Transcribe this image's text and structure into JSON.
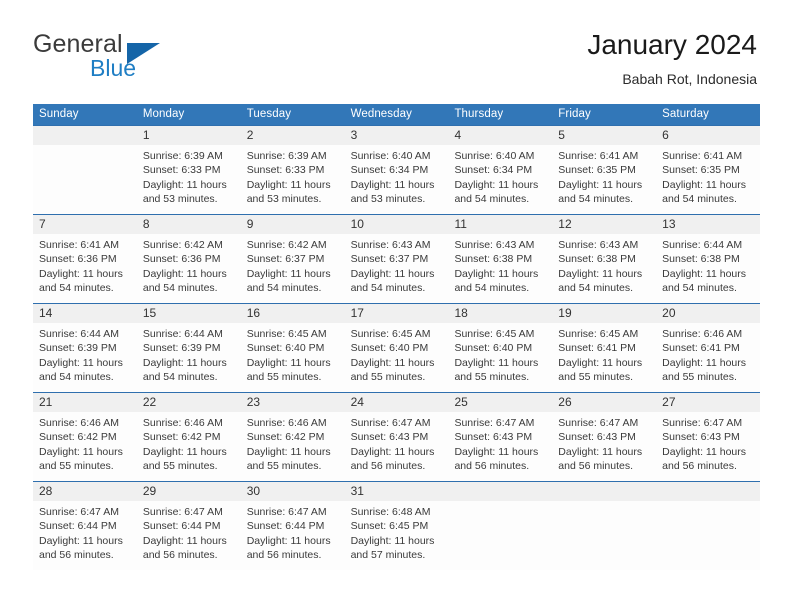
{
  "brand": {
    "name_top": "General",
    "name_bottom": "Blue",
    "triangle_color": "#1565a8",
    "blue_color": "#1f7ec4"
  },
  "header": {
    "title": "January 2024",
    "subtitle": "Babah Rot, Indonesia"
  },
  "theme": {
    "header_blue": "#3277b8",
    "daynum_band": "#f0f0f0",
    "separator_blue": "#2f6fae"
  },
  "weekdays": [
    "Sunday",
    "Monday",
    "Tuesday",
    "Wednesday",
    "Thursday",
    "Friday",
    "Saturday"
  ],
  "weeks": [
    {
      "days": [
        {
          "num": "",
          "l1": "",
          "l2": "",
          "l3": "",
          "l4": ""
        },
        {
          "num": "1",
          "l1": "Sunrise: 6:39 AM",
          "l2": "Sunset: 6:33 PM",
          "l3": "Daylight: 11 hours",
          "l4": "and 53 minutes."
        },
        {
          "num": "2",
          "l1": "Sunrise: 6:39 AM",
          "l2": "Sunset: 6:33 PM",
          "l3": "Daylight: 11 hours",
          "l4": "and 53 minutes."
        },
        {
          "num": "3",
          "l1": "Sunrise: 6:40 AM",
          "l2": "Sunset: 6:34 PM",
          "l3": "Daylight: 11 hours",
          "l4": "and 53 minutes."
        },
        {
          "num": "4",
          "l1": "Sunrise: 6:40 AM",
          "l2": "Sunset: 6:34 PM",
          "l3": "Daylight: 11 hours",
          "l4": "and 54 minutes."
        },
        {
          "num": "5",
          "l1": "Sunrise: 6:41 AM",
          "l2": "Sunset: 6:35 PM",
          "l3": "Daylight: 11 hours",
          "l4": "and 54 minutes."
        },
        {
          "num": "6",
          "l1": "Sunrise: 6:41 AM",
          "l2": "Sunset: 6:35 PM",
          "l3": "Daylight: 11 hours",
          "l4": "and 54 minutes."
        }
      ]
    },
    {
      "days": [
        {
          "num": "7",
          "l1": "Sunrise: 6:41 AM",
          "l2": "Sunset: 6:36 PM",
          "l3": "Daylight: 11 hours",
          "l4": "and 54 minutes."
        },
        {
          "num": "8",
          "l1": "Sunrise: 6:42 AM",
          "l2": "Sunset: 6:36 PM",
          "l3": "Daylight: 11 hours",
          "l4": "and 54 minutes."
        },
        {
          "num": "9",
          "l1": "Sunrise: 6:42 AM",
          "l2": "Sunset: 6:37 PM",
          "l3": "Daylight: 11 hours",
          "l4": "and 54 minutes."
        },
        {
          "num": "10",
          "l1": "Sunrise: 6:43 AM",
          "l2": "Sunset: 6:37 PM",
          "l3": "Daylight: 11 hours",
          "l4": "and 54 minutes."
        },
        {
          "num": "11",
          "l1": "Sunrise: 6:43 AM",
          "l2": "Sunset: 6:38 PM",
          "l3": "Daylight: 11 hours",
          "l4": "and 54 minutes."
        },
        {
          "num": "12",
          "l1": "Sunrise: 6:43 AM",
          "l2": "Sunset: 6:38 PM",
          "l3": "Daylight: 11 hours",
          "l4": "and 54 minutes."
        },
        {
          "num": "13",
          "l1": "Sunrise: 6:44 AM",
          "l2": "Sunset: 6:38 PM",
          "l3": "Daylight: 11 hours",
          "l4": "and 54 minutes."
        }
      ]
    },
    {
      "days": [
        {
          "num": "14",
          "l1": "Sunrise: 6:44 AM",
          "l2": "Sunset: 6:39 PM",
          "l3": "Daylight: 11 hours",
          "l4": "and 54 minutes."
        },
        {
          "num": "15",
          "l1": "Sunrise: 6:44 AM",
          "l2": "Sunset: 6:39 PM",
          "l3": "Daylight: 11 hours",
          "l4": "and 54 minutes."
        },
        {
          "num": "16",
          "l1": "Sunrise: 6:45 AM",
          "l2": "Sunset: 6:40 PM",
          "l3": "Daylight: 11 hours",
          "l4": "and 55 minutes."
        },
        {
          "num": "17",
          "l1": "Sunrise: 6:45 AM",
          "l2": "Sunset: 6:40 PM",
          "l3": "Daylight: 11 hours",
          "l4": "and 55 minutes."
        },
        {
          "num": "18",
          "l1": "Sunrise: 6:45 AM",
          "l2": "Sunset: 6:40 PM",
          "l3": "Daylight: 11 hours",
          "l4": "and 55 minutes."
        },
        {
          "num": "19",
          "l1": "Sunrise: 6:45 AM",
          "l2": "Sunset: 6:41 PM",
          "l3": "Daylight: 11 hours",
          "l4": "and 55 minutes."
        },
        {
          "num": "20",
          "l1": "Sunrise: 6:46 AM",
          "l2": "Sunset: 6:41 PM",
          "l3": "Daylight: 11 hours",
          "l4": "and 55 minutes."
        }
      ]
    },
    {
      "days": [
        {
          "num": "21",
          "l1": "Sunrise: 6:46 AM",
          "l2": "Sunset: 6:42 PM",
          "l3": "Daylight: 11 hours",
          "l4": "and 55 minutes."
        },
        {
          "num": "22",
          "l1": "Sunrise: 6:46 AM",
          "l2": "Sunset: 6:42 PM",
          "l3": "Daylight: 11 hours",
          "l4": "and 55 minutes."
        },
        {
          "num": "23",
          "l1": "Sunrise: 6:46 AM",
          "l2": "Sunset: 6:42 PM",
          "l3": "Daylight: 11 hours",
          "l4": "and 55 minutes."
        },
        {
          "num": "24",
          "l1": "Sunrise: 6:47 AM",
          "l2": "Sunset: 6:43 PM",
          "l3": "Daylight: 11 hours",
          "l4": "and 56 minutes."
        },
        {
          "num": "25",
          "l1": "Sunrise: 6:47 AM",
          "l2": "Sunset: 6:43 PM",
          "l3": "Daylight: 11 hours",
          "l4": "and 56 minutes."
        },
        {
          "num": "26",
          "l1": "Sunrise: 6:47 AM",
          "l2": "Sunset: 6:43 PM",
          "l3": "Daylight: 11 hours",
          "l4": "and 56 minutes."
        },
        {
          "num": "27",
          "l1": "Sunrise: 6:47 AM",
          "l2": "Sunset: 6:43 PM",
          "l3": "Daylight: 11 hours",
          "l4": "and 56 minutes."
        }
      ]
    },
    {
      "days": [
        {
          "num": "28",
          "l1": "Sunrise: 6:47 AM",
          "l2": "Sunset: 6:44 PM",
          "l3": "Daylight: 11 hours",
          "l4": "and 56 minutes."
        },
        {
          "num": "29",
          "l1": "Sunrise: 6:47 AM",
          "l2": "Sunset: 6:44 PM",
          "l3": "Daylight: 11 hours",
          "l4": "and 56 minutes."
        },
        {
          "num": "30",
          "l1": "Sunrise: 6:47 AM",
          "l2": "Sunset: 6:44 PM",
          "l3": "Daylight: 11 hours",
          "l4": "and 56 minutes."
        },
        {
          "num": "31",
          "l1": "Sunrise: 6:48 AM",
          "l2": "Sunset: 6:45 PM",
          "l3": "Daylight: 11 hours",
          "l4": "and 57 minutes."
        },
        {
          "num": "",
          "l1": "",
          "l2": "",
          "l3": "",
          "l4": ""
        },
        {
          "num": "",
          "l1": "",
          "l2": "",
          "l3": "",
          "l4": ""
        },
        {
          "num": "",
          "l1": "",
          "l2": "",
          "l3": "",
          "l4": ""
        }
      ]
    }
  ]
}
